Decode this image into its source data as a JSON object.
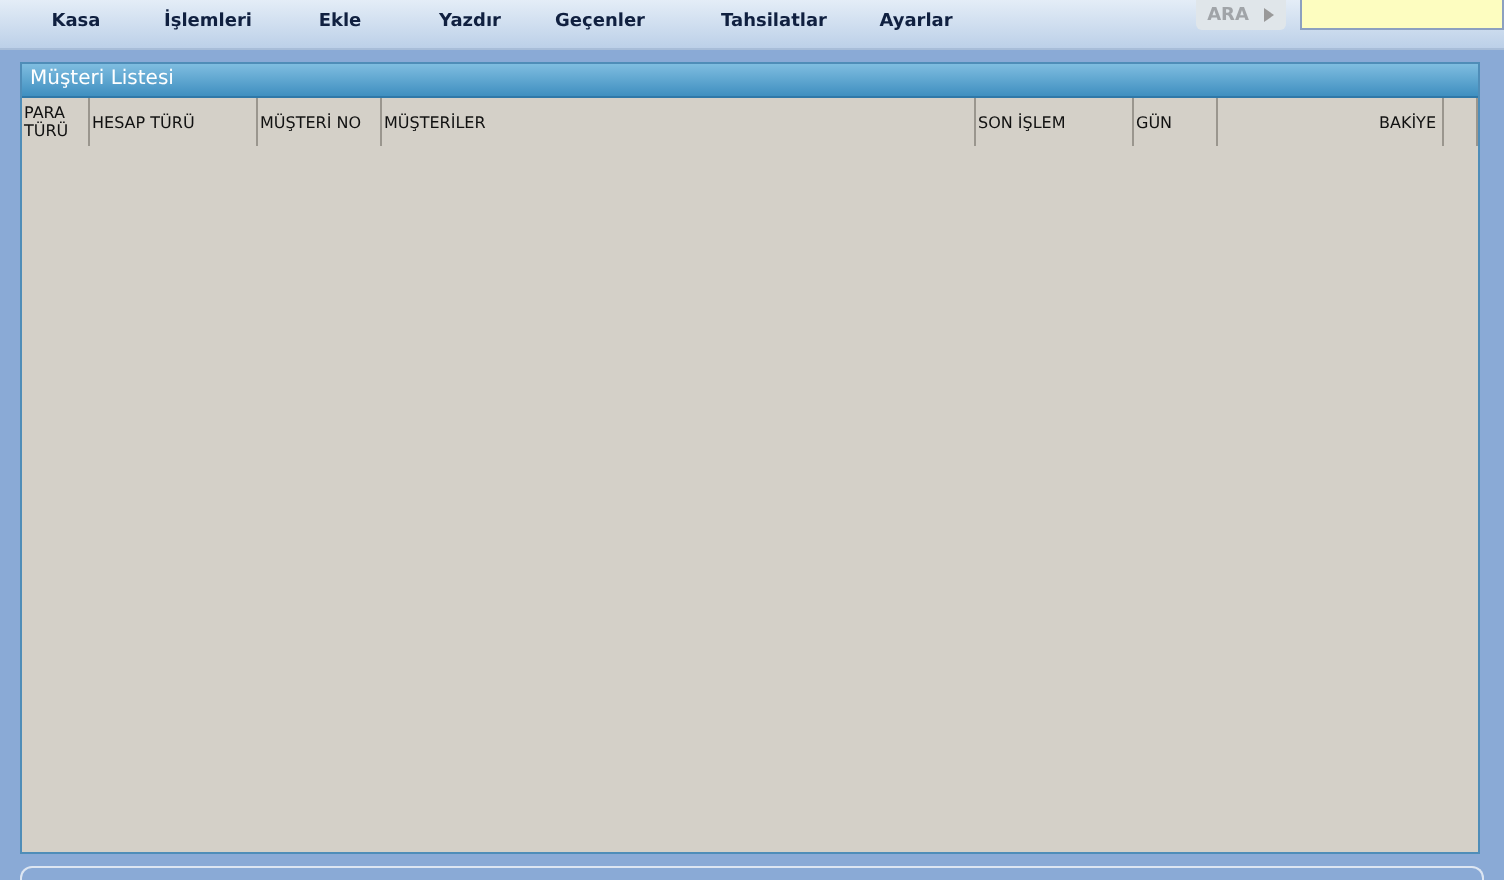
{
  "toolbar": {
    "buttons": [
      {
        "label": "Kasa"
      },
      {
        "label": "İşlemleri"
      },
      {
        "label": "Ekle"
      },
      {
        "label": "Yazdır"
      },
      {
        "label": "Geçenler"
      },
      {
        "label": "Tahsilatlar"
      },
      {
        "label": "Ayarlar"
      }
    ],
    "search_button": {
      "label": "ARA",
      "disabled": true
    }
  },
  "panel": {
    "title": "Müşteri Listesi",
    "columns": [
      {
        "label": "PARA TÜRÜ",
        "right_aligned": false
      },
      {
        "label": "HESAP TÜRÜ",
        "right_aligned": false
      },
      {
        "label": "MÜŞTERİ NO",
        "right_aligned": false
      },
      {
        "label": "MÜŞTERİLER",
        "right_aligned": false
      },
      {
        "label": "SON İŞLEM",
        "right_aligned": false
      },
      {
        "label": "GÜN",
        "right_aligned": false
      },
      {
        "label": "BAKİYE",
        "right_aligned": true
      }
    ]
  }
}
